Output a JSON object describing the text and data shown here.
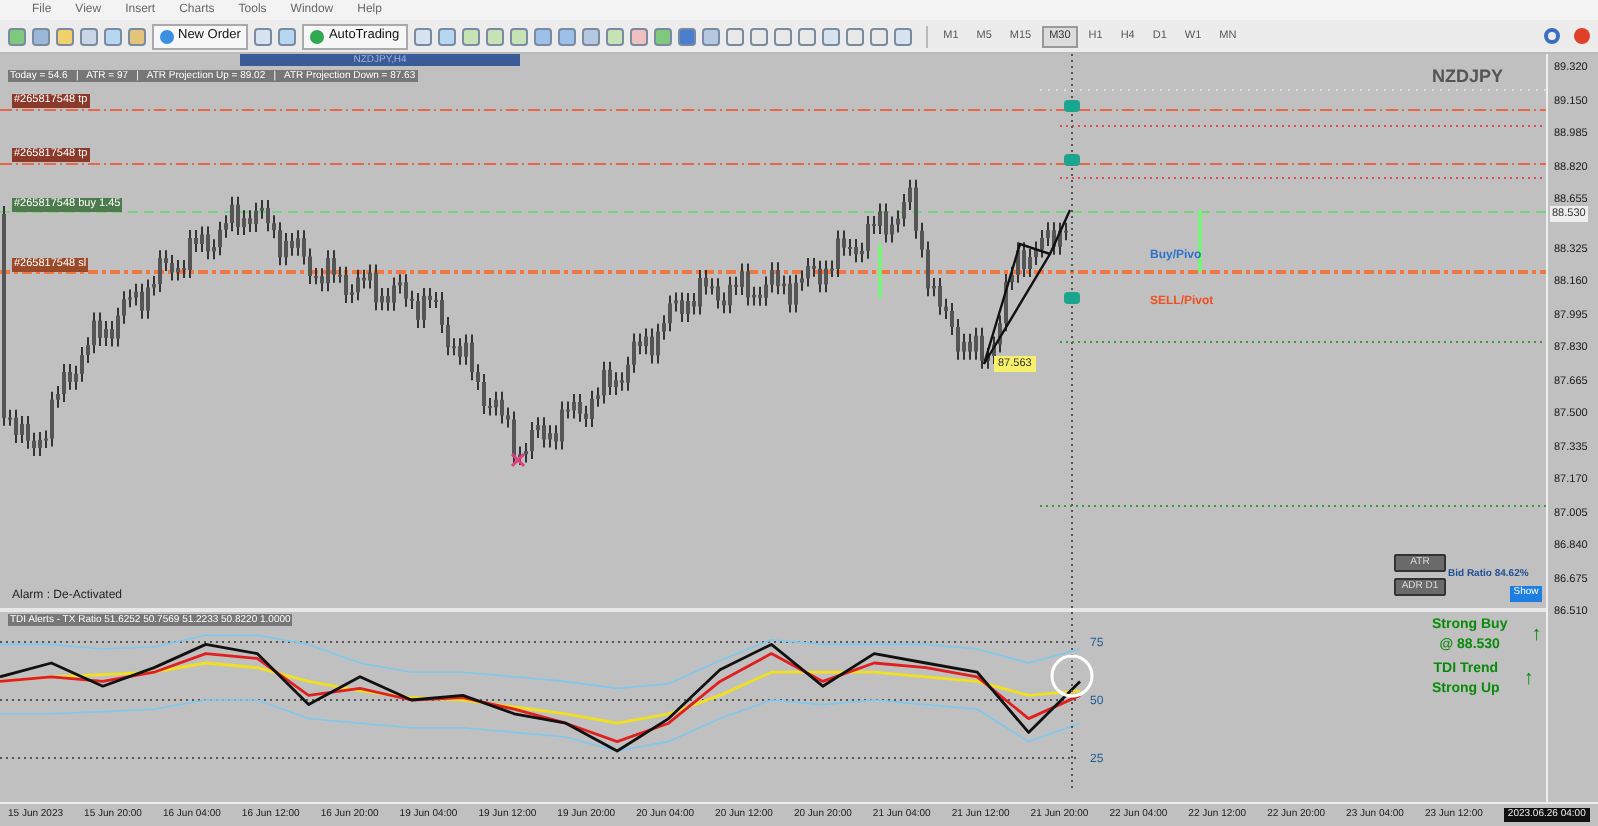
{
  "menu": [
    "File",
    "View",
    "Insert",
    "Charts",
    "Tools",
    "Window",
    "Help"
  ],
  "toolbar": {
    "buttons": [
      {
        "label": "New Order",
        "kind": "order"
      },
      {
        "label": "AutoTrading",
        "kind": "auto"
      }
    ],
    "timeframes": [
      {
        "label": "M1",
        "selected": false
      },
      {
        "label": "M5",
        "selected": false
      },
      {
        "label": "M15",
        "selected": false
      },
      {
        "label": "M30",
        "selected": true
      },
      {
        "label": "H1",
        "selected": false
      },
      {
        "label": "H4",
        "selected": false
      },
      {
        "label": "D1",
        "selected": false
      },
      {
        "label": "W1",
        "selected": false
      },
      {
        "label": "MN",
        "selected": false
      }
    ]
  },
  "chart": {
    "window_title": "NZDJPY,H4",
    "symbol": "NZDJPY",
    "info_line": "Today = 54.6   |   ATR = 97   |   ATR Projection Up = 89.02   |   ATR Projection Down = 87.63",
    "level_labels": [
      {
        "text": "#265817548 tp",
        "kind": "tp"
      },
      {
        "text": "#265817548 tp",
        "kind": "tp"
      },
      {
        "text": "#265817548 buy 1.45",
        "kind": "buy"
      },
      {
        "text": "#265817548 sl",
        "kind": "sl"
      }
    ],
    "pivot_labels": [
      {
        "text": "Buy/Pivo",
        "kind": "buy"
      },
      {
        "text": "SELL/Pivot",
        "kind": "sell"
      }
    ],
    "low_tag": "87.563",
    "alarm": "Alarm : De-Activated",
    "panel_buttons": [
      "ATR",
      "ADR D1"
    ],
    "bid_ratio": "Bid Ratio 84.62%",
    "show_button": "Show",
    "signals": [
      {
        "lines": [
          "Strong Buy",
          "@ 88.530"
        ],
        "arrow": "↑"
      },
      {
        "lines": [
          "TDI Trend",
          "Strong Up"
        ],
        "arrow": "↑"
      }
    ],
    "price_axis": [
      "89.320",
      "89.150",
      "88.985",
      "88.820",
      "88.655",
      "88.325",
      "88.160",
      "87.995",
      "87.830",
      "87.665",
      "87.500",
      "87.335",
      "87.170",
      "87.005",
      "86.840",
      "86.675",
      "86.510"
    ],
    "current_price": "88.530"
  },
  "indicator": {
    "label": "TDI Alerts - TX Ratio 51.6252 50.7569 51.2233 50.8220 1.0000",
    "chart_data": {
      "type": "line",
      "grid": true,
      "ylim": [
        12,
        88
      ],
      "yticks": [
        75,
        50,
        25
      ],
      "series": [
        {
          "color": "#7ec8f0",
          "values": [
            74,
            74,
            72,
            73,
            78,
            78,
            74,
            66,
            62,
            62,
            60,
            58,
            55,
            57,
            67,
            76,
            74,
            74,
            74,
            72,
            66,
            72
          ]
        },
        {
          "color": "#7ec8f0",
          "values": [
            44,
            44,
            45,
            46,
            50,
            50,
            42,
            40,
            38,
            38,
            36,
            34,
            28,
            32,
            42,
            50,
            48,
            50,
            48,
            46,
            32,
            40
          ]
        },
        {
          "color": "#f0e020",
          "values": [
            58,
            60,
            61,
            62,
            66,
            64,
            58,
            54,
            51,
            50,
            47,
            44,
            40,
            44,
            52,
            62,
            62,
            62,
            60,
            58,
            52,
            54
          ]
        },
        {
          "color": "#e02020",
          "values": [
            58,
            60,
            58,
            62,
            70,
            68,
            52,
            55,
            50,
            51,
            46,
            40,
            32,
            40,
            58,
            70,
            58,
            66,
            64,
            60,
            42,
            52
          ]
        },
        {
          "color": "#111111",
          "values": [
            60,
            66,
            56,
            64,
            74,
            70,
            48,
            60,
            50,
            52,
            44,
            40,
            28,
            42,
            63,
            74,
            56,
            70,
            66,
            62,
            36,
            58
          ]
        }
      ]
    }
  },
  "time_axis": [
    "15 Jun 2023",
    "15 Jun 20:00",
    "16 Jun 04:00",
    "16 Jun 12:00",
    "16 Jun 20:00",
    "19 Jun 04:00",
    "19 Jun 12:00",
    "19 Jun 20:00",
    "20 Jun 04:00",
    "20 Jun 12:00",
    "20 Jun 20:00",
    "21 Jun 04:00",
    "21 Jun 12:00",
    "21 Jun 20:00",
    "22 Jun 04:00",
    "22 Jun 12:00",
    "22 Jun 20:00",
    "23 Jun 04:00",
    "23 Jun 12:00"
  ],
  "current_time": "2023.06.26 04:00"
}
